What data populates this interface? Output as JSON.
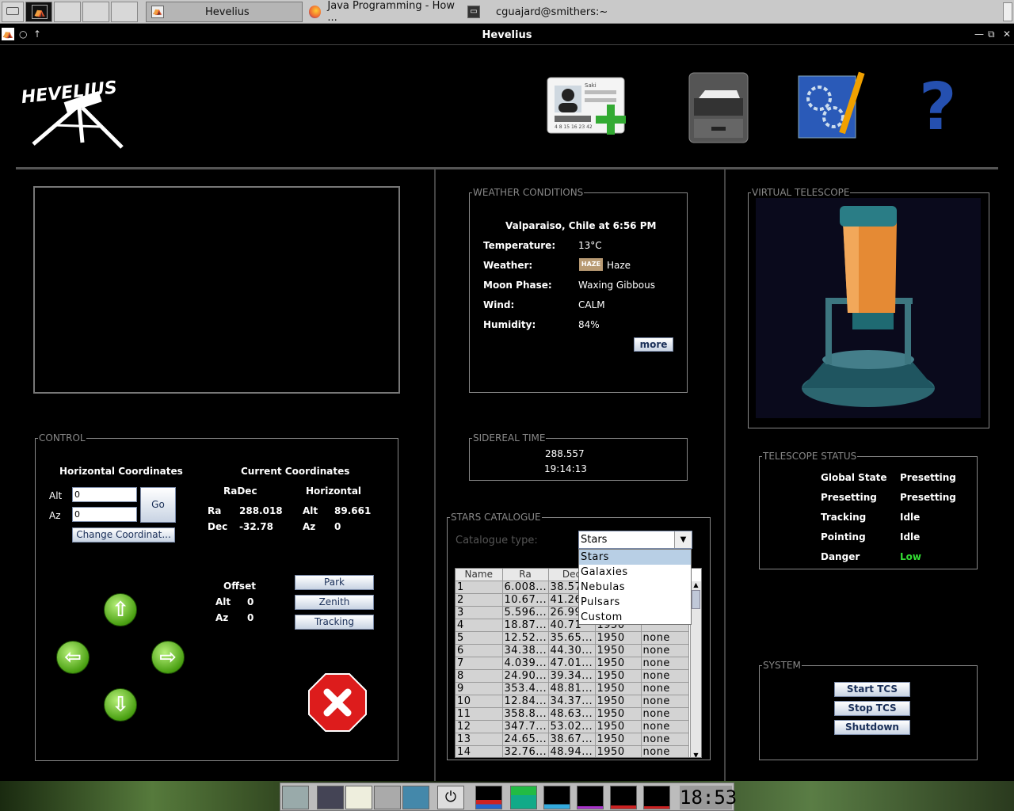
{
  "taskbar": {
    "tasks": [
      {
        "label": "Hevelius"
      },
      {
        "label": "Java Programming - How ..."
      },
      {
        "label": "cguajard@smithers:~"
      }
    ]
  },
  "window": {
    "title": "Hevelius"
  },
  "header": {
    "logo_text": "HEVELIUS",
    "icons": [
      "add-user-icon",
      "file-cabinet-icon",
      "settings-blueprint-icon",
      "help-icon"
    ],
    "id_card_name": "Saki",
    "id_card_number": "4 8 15 16 23 42",
    "help_glyph": "?"
  },
  "control": {
    "title": "CONTROL",
    "horizontal_title": "Horizontal Coordinates",
    "alt_label": "Alt",
    "alt_value": "0",
    "az_label": "Az",
    "az_value": "0",
    "go_label": "Go",
    "change_label": "Change Coordinat...",
    "current_title": "Current Coordinates",
    "radec_title": "RaDec",
    "horizontal_sub": "Horizontal",
    "ra_label": "Ra",
    "ra_value": "288.018",
    "dec_label": "Dec",
    "dec_value": "-32.78",
    "cur_alt_label": "Alt",
    "cur_alt_value": "89.661",
    "cur_az_label": "Az",
    "cur_az_value": "0",
    "offset_title": "Offset",
    "off_alt_label": "Alt",
    "off_alt_value": "0",
    "off_az_label": "Az",
    "off_az_value": "0",
    "park_label": "Park",
    "zenith_label": "Zenith",
    "tracking_label": "Tracking"
  },
  "weather": {
    "title": "WEATHER CONDITIONS",
    "location": "Valparaiso, Chile at 6:56 PM",
    "rows": [
      {
        "label": "Temperature:",
        "value": "13°C"
      },
      {
        "label": "Weather:",
        "value": "Haze"
      },
      {
        "label": "Moon Phase:",
        "value": "Waxing Gibbous"
      },
      {
        "label": "Wind:",
        "value": "CALM"
      },
      {
        "label": "Humidity:",
        "value": "84%"
      }
    ],
    "haze_badge": "HAZE",
    "more_label": "more"
  },
  "sidereal": {
    "title": "SIDEREAL TIME",
    "value1": "288.557",
    "value2": "19:14:13"
  },
  "catalogue": {
    "title": "STARS CATALOGUE",
    "type_label": "Catalogue type:",
    "selected": "Stars",
    "options": [
      "Stars",
      "Galaxies",
      "Nebulas",
      "Pulsars",
      "Custom"
    ],
    "columns": [
      "Name",
      "Ra",
      "Dec",
      "",
      ""
    ],
    "rows": [
      [
        "1",
        "6.008...",
        "38.57",
        "",
        ""
      ],
      [
        "2",
        "10.67...",
        "41.26",
        "",
        ""
      ],
      [
        "3",
        "5.596...",
        "26.99",
        "",
        ""
      ],
      [
        "4",
        "18.87...",
        "40.71",
        "1950",
        ""
      ],
      [
        "5",
        "12.52...",
        "35.65...",
        "1950",
        "none"
      ],
      [
        "6",
        "34.38...",
        "44.30...",
        "1950",
        "none"
      ],
      [
        "7",
        "4.039...",
        "47.01...",
        "1950",
        "none"
      ],
      [
        "8",
        "24.90...",
        "39.34...",
        "1950",
        "none"
      ],
      [
        "9",
        "353.4...",
        "48.81...",
        "1950",
        "none"
      ],
      [
        "10",
        "12.84...",
        "34.37...",
        "1950",
        "none"
      ],
      [
        "11",
        "358.8...",
        "48.63...",
        "1950",
        "none"
      ],
      [
        "12",
        "347.7...",
        "53.02...",
        "1950",
        "none"
      ],
      [
        "13",
        "24.65...",
        "38.67...",
        "1950",
        "none"
      ],
      [
        "14",
        "32.76...",
        "48.94...",
        "1950",
        "none"
      ]
    ]
  },
  "virtual": {
    "title": "VIRTUAL TELESCOPE"
  },
  "status": {
    "title": "TELESCOPE STATUS",
    "rows": [
      {
        "label": "Global State",
        "value": "Presetting"
      },
      {
        "label": "Presetting",
        "value": "Presetting"
      },
      {
        "label": "Tracking",
        "value": "Idle"
      },
      {
        "label": "Pointing",
        "value": "Idle"
      },
      {
        "label": "Danger",
        "value": "Low"
      }
    ],
    "danger_color": "#33dd33"
  },
  "system": {
    "title": "SYSTEM",
    "start_label": "Start TCS",
    "stop_label": "Stop TCS",
    "shutdown_label": "Shutdown"
  },
  "dock": {
    "clock": "18:53"
  }
}
